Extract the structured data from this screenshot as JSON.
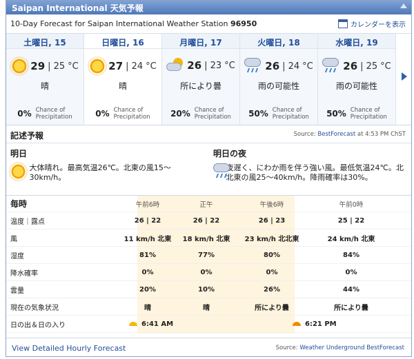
{
  "title": "Saipan International 天気予報",
  "subhead": {
    "prefix": "10-Day Forecast for Saipan International Weather Station",
    "station_id": "96950",
    "calendar_label": "カレンダーを表示"
  },
  "days": [
    {
      "name": "土曜日, 15",
      "hi": "29",
      "lo": "25",
      "unit": "°C",
      "cond": "晴",
      "icon": "sun-icon",
      "precip": "0%",
      "highlight": false
    },
    {
      "name": "日曜日, 16",
      "hi": "27",
      "lo": "24",
      "unit": "°C",
      "cond": "晴",
      "icon": "sun-icon",
      "precip": "0%",
      "highlight": true
    },
    {
      "name": "月曜日, 17",
      "hi": "26",
      "lo": "23",
      "unit": "°C",
      "cond": "所により曇",
      "icon": "partly-cloudy-icon",
      "precip": "20%",
      "highlight": false
    },
    {
      "name": "火曜日, 18",
      "hi": "26",
      "lo": "24",
      "unit": "°C",
      "cond": "雨の可能性",
      "icon": "rain-icon",
      "precip": "50%",
      "highlight": false
    },
    {
      "name": "水曜日, 19",
      "hi": "26",
      "lo": "25",
      "unit": "°C",
      "cond": "雨の可能性",
      "icon": "rain-icon",
      "precip": "50%",
      "highlight": false
    }
  ],
  "precip_label_1": "Chance of",
  "precip_label_2": "Precipitation",
  "narrative": {
    "title": "記述予報",
    "source_prefix": "Source:",
    "source_link": "BestForecast",
    "source_time": "at 4:53 PM ChST",
    "today": {
      "title": "明日",
      "text": "大体晴れ。最高気温26℃。北東の風15〜30km/h。"
    },
    "tonight": {
      "title": "明日の夜",
      "text": "夜遅く、にわか雨を伴う強い風。最低気温24℃。北北東の風25〜40km/h。降雨確率は30%。"
    }
  },
  "hourly": {
    "title": "毎時",
    "times": [
      "午前6時",
      "正午",
      "午後6時",
      "午前0時"
    ],
    "rows": [
      {
        "label": "温度｜露点",
        "values": [
          "26 | 22",
          "26 | 22",
          "26 | 23",
          "25 | 22"
        ]
      },
      {
        "label": "風",
        "values": [
          "11 km/h 北東",
          "18 km/h 北東",
          "23 km/h 北北東",
          "24 km/h 北東"
        ]
      },
      {
        "label": "湿度",
        "values": [
          "81%",
          "77%",
          "80%",
          "84%"
        ]
      },
      {
        "label": "降水確率",
        "values": [
          "0%",
          "0%",
          "0%",
          "0%"
        ]
      },
      {
        "label": "雲量",
        "values": [
          "20%",
          "10%",
          "26%",
          "44%"
        ]
      },
      {
        "label": "現在の気象状況",
        "values": [
          "晴",
          "晴",
          "所により曇",
          "所により曇"
        ]
      }
    ],
    "sunrise_label": "日の出＆日の入り",
    "sunrise": "6:41 AM",
    "sunset": "6:21 PM"
  },
  "footer": {
    "link": "View Detailed Hourly Forecast",
    "source_prefix": "Source:",
    "source_link": "Weather Underground BestForecast"
  }
}
